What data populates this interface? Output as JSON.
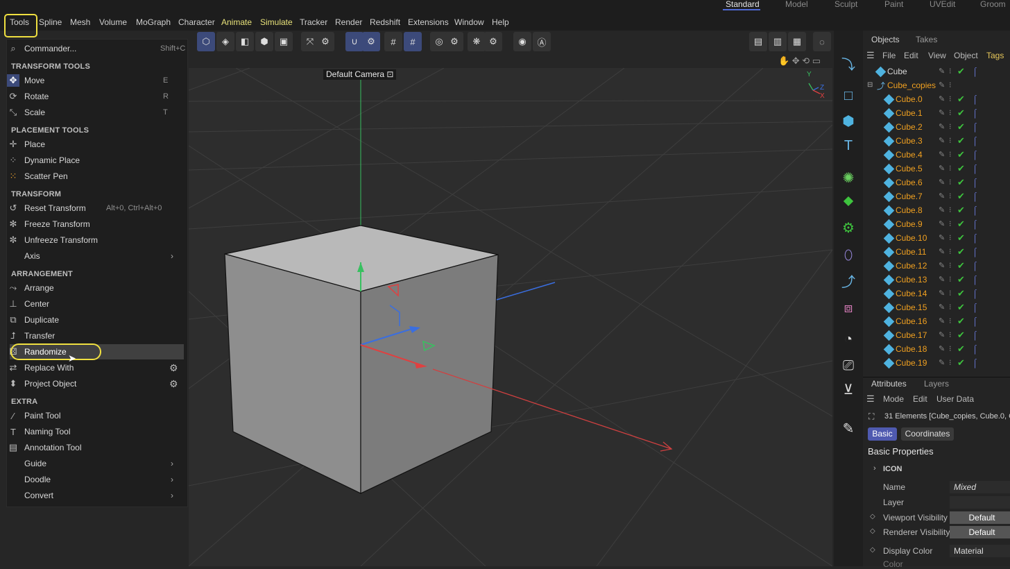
{
  "layouts": [
    "Standard",
    "Model",
    "Sculpt",
    "Paint",
    "UVEdit",
    "Groom"
  ],
  "menubar": [
    "Tools",
    "Spline",
    "Mesh",
    "Volume",
    "MoGraph",
    "Character",
    "Animate",
    "Simulate",
    "Tracker",
    "Render",
    "Redshift",
    "Extensions",
    "Window",
    "Help"
  ],
  "viewport": {
    "camera": "Default Camera",
    "axis": {
      "y": "Y",
      "z": "Z",
      "x": "X"
    }
  },
  "tools_menu": {
    "commander": {
      "label": "Commander...",
      "shortcut": "Shift+C"
    },
    "sections": {
      "transform_tools": "TRANSFORM TOOLS",
      "placement_tools": "PLACEMENT TOOLS",
      "transform": "TRANSFORM",
      "arrangement": "ARRANGEMENT",
      "extra": "EXTRA"
    },
    "items": {
      "move": {
        "label": "Move",
        "shortcut": "E"
      },
      "rotate": {
        "label": "Rotate",
        "shortcut": "R"
      },
      "scale": {
        "label": "Scale",
        "shortcut": "T"
      },
      "place": "Place",
      "dynamic_place": "Dynamic Place",
      "scatter_pen": "Scatter Pen",
      "reset_transform": {
        "label": "Reset Transform",
        "shortcut": "Alt+0, Ctrl+Alt+0"
      },
      "freeze_transform": "Freeze Transform",
      "unfreeze_transform": "Unfreeze Transform",
      "axis": "Axis",
      "arrange": "Arrange",
      "center": "Center",
      "duplicate": "Duplicate",
      "transfer": "Transfer",
      "randomize": "Randomize",
      "replace_with": "Replace With",
      "project_object": "Project Object",
      "paint_tool": "Paint Tool",
      "naming_tool": "Naming Tool",
      "annotation_tool": "Annotation Tool",
      "guide": "Guide",
      "doodle": "Doodle",
      "convert": "Convert"
    }
  },
  "objects_panel": {
    "tabs": [
      "Objects",
      "Takes"
    ],
    "menu": [
      "File",
      "Edit",
      "View",
      "Object",
      "Tags"
    ],
    "root": [
      "Cube",
      "Cube_copies"
    ],
    "children": [
      "Cube.0",
      "Cube.1",
      "Cube.2",
      "Cube.3",
      "Cube.4",
      "Cube.5",
      "Cube.6",
      "Cube.7",
      "Cube.8",
      "Cube.9",
      "Cube.10",
      "Cube.11",
      "Cube.12",
      "Cube.13",
      "Cube.14",
      "Cube.15",
      "Cube.16",
      "Cube.17",
      "Cube.18",
      "Cube.19"
    ]
  },
  "attributes_panel": {
    "tabs": [
      "Attributes",
      "Layers"
    ],
    "menu": [
      "Mode",
      "Edit",
      "User Data"
    ],
    "selection": "31 Elements [Cube_copies, Cube.0, C",
    "subtabs": [
      "Basic",
      "Coordinates"
    ],
    "heading": "Basic Properties",
    "group": "ICON",
    "fields": {
      "name": {
        "label": "Name",
        "value": "Mixed"
      },
      "layer": {
        "label": "Layer",
        "value": ""
      },
      "viewport_visibility": {
        "label": "Viewport Visibility",
        "value": "Default"
      },
      "renderer_visibility": {
        "label": "Renderer Visibility",
        "value": "Default"
      },
      "display_color": {
        "label": "Display Color",
        "value": "Material"
      },
      "color": {
        "label": "Color"
      }
    }
  },
  "colors": {
    "accent": "#4f6ad6",
    "highlight": "#f0e040",
    "object_orange": "#f0a020",
    "check_green": "#3ec43e"
  }
}
